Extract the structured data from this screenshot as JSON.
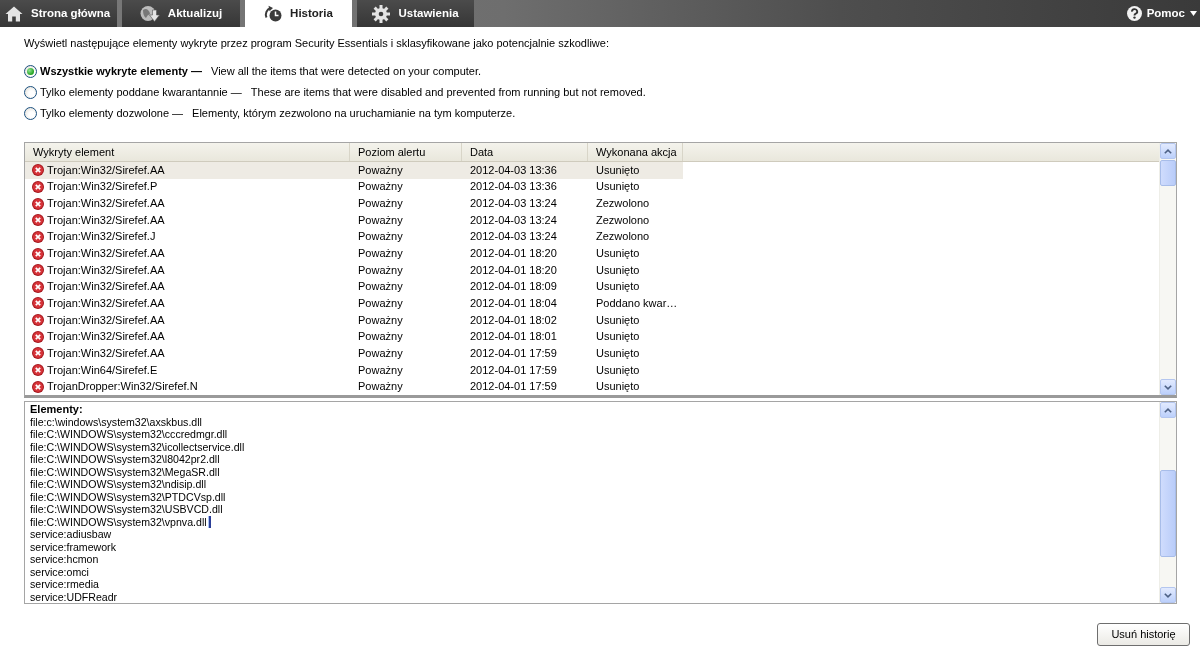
{
  "tabs": [
    {
      "label": "Strona główna",
      "selected": false
    },
    {
      "label": "Aktualizuj",
      "selected": false
    },
    {
      "label": "Historia",
      "selected": true
    },
    {
      "label": "Ustawienia",
      "selected": false
    }
  ],
  "help_menu": {
    "label": "Pomoc"
  },
  "intro": "Wyświetl następujące elementy wykryte przez program Security Essentials i sklasyfikowane jako potencjalnie szkodliwe:",
  "filters": [
    {
      "label": "Wszystkie wykryte elementy —",
      "description": "View all the items that were detected on your computer.",
      "selected": true
    },
    {
      "label": "Tylko elementy poddane kwarantannie —",
      "description": "These are items that were disabled and prevented from running but not removed.",
      "selected": false
    },
    {
      "label": "Tylko elementy dozwolone —",
      "description": "Elementy, którym zezwolono na uruchamianie na tym komputerze.",
      "selected": false
    }
  ],
  "table": {
    "columns": [
      "Wykryty element",
      "Poziom alertu",
      "Data",
      "Wykonana akcja"
    ],
    "rows": [
      {
        "cells": [
          "Trojan:Win32/Sirefef.AA",
          "Poważny",
          "2012-04-03 13:36",
          "Usunięto"
        ],
        "selected": true
      },
      {
        "cells": [
          "Trojan:Win32/Sirefef.P",
          "Poważny",
          "2012-04-03 13:36",
          "Usunięto"
        ],
        "selected": false
      },
      {
        "cells": [
          "Trojan:Win32/Sirefef.AA",
          "Poważny",
          "2012-04-03 13:24",
          "Zezwolono"
        ],
        "selected": false
      },
      {
        "cells": [
          "Trojan:Win32/Sirefef.AA",
          "Poważny",
          "2012-04-03 13:24",
          "Zezwolono"
        ],
        "selected": false
      },
      {
        "cells": [
          "Trojan:Win32/Sirefef.J",
          "Poważny",
          "2012-04-03 13:24",
          "Zezwolono"
        ],
        "selected": false
      },
      {
        "cells": [
          "Trojan:Win32/Sirefef.AA",
          "Poważny",
          "2012-04-01 18:20",
          "Usunięto"
        ],
        "selected": false
      },
      {
        "cells": [
          "Trojan:Win32/Sirefef.AA",
          "Poważny",
          "2012-04-01 18:20",
          "Usunięto"
        ],
        "selected": false
      },
      {
        "cells": [
          "Trojan:Win32/Sirefef.AA",
          "Poważny",
          "2012-04-01 18:09",
          "Usunięto"
        ],
        "selected": false
      },
      {
        "cells": [
          "Trojan:Win32/Sirefef.AA",
          "Poważny",
          "2012-04-01 18:04",
          "Poddano kwar…"
        ],
        "selected": false
      },
      {
        "cells": [
          "Trojan:Win32/Sirefef.AA",
          "Poważny",
          "2012-04-01 18:02",
          "Usunięto"
        ],
        "selected": false
      },
      {
        "cells": [
          "Trojan:Win32/Sirefef.AA",
          "Poważny",
          "2012-04-01 18:01",
          "Usunięto"
        ],
        "selected": false
      },
      {
        "cells": [
          "Trojan:Win32/Sirefef.AA",
          "Poważny",
          "2012-04-01 17:59",
          "Usunięto"
        ],
        "selected": false
      },
      {
        "cells": [
          "Trojan:Win64/Sirefef.E",
          "Poważny",
          "2012-04-01 17:59",
          "Usunięto"
        ],
        "selected": false
      },
      {
        "cells": [
          "TrojanDropper:Win32/Sirefef.N",
          "Poważny",
          "2012-04-01 17:59",
          "Usunięto"
        ],
        "selected": false
      }
    ]
  },
  "details": {
    "heading": "Elementy:",
    "lines": [
      {
        "text": "file:c:\\windows\\system32\\axskbus.dll",
        "caret": false
      },
      {
        "text": "file:C:\\WINDOWS\\system32\\cccredmgr.dll",
        "caret": false
      },
      {
        "text": "file:C:\\WINDOWS\\system32\\icollectservice.dll",
        "caret": false
      },
      {
        "text": "file:C:\\WINDOWS\\system32\\l8042pr2.dll",
        "caret": false
      },
      {
        "text": "file:C:\\WINDOWS\\system32\\MegaSR.dll",
        "caret": false
      },
      {
        "text": "file:C:\\WINDOWS\\system32\\ndisip.dll",
        "caret": false
      },
      {
        "text": "file:C:\\WINDOWS\\system32\\PTDCVsp.dll",
        "caret": false
      },
      {
        "text": "file:C:\\WINDOWS\\system32\\USBVCD.dll",
        "caret": false
      },
      {
        "text": "file:C:\\WINDOWS\\system32\\vpnva.dll",
        "caret": true
      },
      {
        "text": "service:adiusbaw",
        "caret": false
      },
      {
        "text": "service:framework",
        "caret": false
      },
      {
        "text": "service:hcmon",
        "caret": false
      },
      {
        "text": "service:omci",
        "caret": false
      },
      {
        "text": "service:rmedia",
        "caret": false
      },
      {
        "text": "service:UDFReadr",
        "caret": false
      }
    ]
  },
  "buttons": [
    "Usuń historię"
  ]
}
